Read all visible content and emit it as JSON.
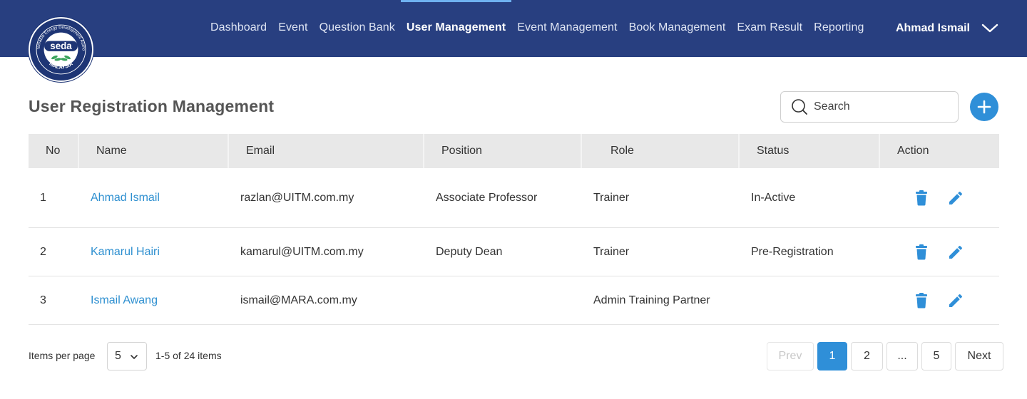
{
  "logo": {
    "brand_text": "seda",
    "ring_text": "Sustainable Energy Development Authority",
    "country_text": "MALAYSIA"
  },
  "nav": {
    "items": [
      {
        "label": "Dashboard",
        "active": false
      },
      {
        "label": "Event",
        "active": false
      },
      {
        "label": "Question Bank",
        "active": false
      },
      {
        "label": "User Management",
        "active": true
      },
      {
        "label": "Event Management",
        "active": false
      },
      {
        "label": "Book Management",
        "active": false
      },
      {
        "label": "Exam Result",
        "active": false
      },
      {
        "label": "Reporting",
        "active": false
      }
    ],
    "user_name": "Ahmad Ismail",
    "user_menu_icon": "chevron-down-icon"
  },
  "page": {
    "title": "User Registration Management",
    "search_placeholder": "Search",
    "search_icon": "search-icon",
    "add_icon": "plus-icon"
  },
  "table": {
    "headers": [
      "No",
      "Name",
      "Email",
      "Position",
      "Role",
      "Status",
      "Action"
    ],
    "rows": [
      {
        "no": "1",
        "name": "Ahmad Ismail",
        "email": "razlan@UITM.com.my",
        "position": "Associate Professor",
        "role": "Trainer",
        "status": "In-Active"
      },
      {
        "no": "2",
        "name": "Kamarul Hairi",
        "email": "kamarul@UITM.com.my",
        "position": "Deputy Dean",
        "role": "Trainer",
        "status": "Pre-Registration"
      },
      {
        "no": "3",
        "name": "Ismail Awang",
        "email": "ismail@MARA.com.my",
        "position": "",
        "role": "Admin Training Partner",
        "status": ""
      }
    ],
    "row_action_icons": [
      "trash-icon",
      "pencil-icon"
    ]
  },
  "footer": {
    "items_per_page_label": "Items per page",
    "items_per_page_value": "5",
    "range_text": "1-5 of 24 items",
    "pagination": {
      "prev": "Prev",
      "pages": [
        "1",
        "2",
        "...",
        "5"
      ],
      "current": "1",
      "next": "Next"
    }
  },
  "colors": {
    "header_bg": "#283f80",
    "accent": "#2f8fd8",
    "link": "#2d8fd0",
    "active_indicator": "#6fb1f0"
  }
}
